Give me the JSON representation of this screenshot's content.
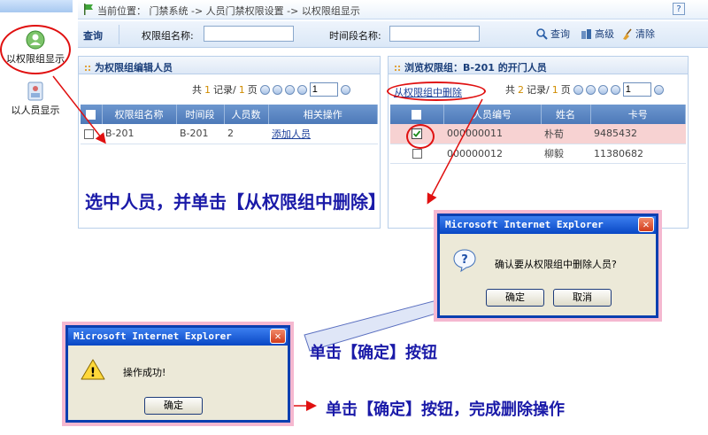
{
  "leftnav": {
    "items": [
      {
        "label": "以权限组显示"
      },
      {
        "label": "以人员显示"
      }
    ]
  },
  "breadcrumb": {
    "text": "当前位置： 门禁系统 -> 人员门禁权限设置 -> 以权限组显示",
    "help": "?"
  },
  "search": {
    "title": "查询",
    "group_label": "权限组名称:",
    "group_value": "",
    "period_label": "时间段名称:",
    "period_value": "",
    "query_label": "查询",
    "advanced_label": "高级",
    "clear_label": "清除"
  },
  "left_panel": {
    "title": "为权限组编辑人员",
    "pager": {
      "prefix": "共",
      "count": "1",
      "mid": "记录/",
      "pages": "1",
      "suffix": "页",
      "page_value": "1"
    },
    "columns": [
      "权限组名称",
      "时间段",
      "人员数",
      "相关操作"
    ],
    "rows": [
      {
        "name": "B-201",
        "period": "B-201",
        "count": "2",
        "action": "添加人员"
      }
    ]
  },
  "right_panel": {
    "title": "浏览权限组：B-201 的开门人员",
    "remove_link": "从权限组中删除",
    "pager": {
      "prefix": "共",
      "count": "2",
      "mid": "记录/",
      "pages": "1",
      "suffix": "页",
      "page_value": "1"
    },
    "columns": [
      "人员编号",
      "姓名",
      "卡号"
    ],
    "rows": [
      {
        "id": "000000011",
        "name": "朴荀",
        "card": "9485432",
        "checked": true
      },
      {
        "id": "000000012",
        "name": "柳毅",
        "card": "11380682",
        "checked": false
      }
    ]
  },
  "annotations": {
    "step1": "选中人员，并单击【从权限组中删除】",
    "step2": "单击【确定】按钮",
    "step3": "单击【确定】按钮，完成删除操作"
  },
  "confirm_dialog": {
    "title": "Microsoft Internet Explorer",
    "message": "确认要从权限组中删除人员?",
    "ok": "确定",
    "cancel": "取消",
    "close": "✕"
  },
  "success_dialog": {
    "title": "Microsoft Internet Explorer",
    "message": "操作成功!",
    "ok": "确定",
    "close": "✕"
  },
  "colors": {
    "accent": "#0847c4",
    "highlight": "#e01010",
    "annotation": "#1a1aa8"
  }
}
